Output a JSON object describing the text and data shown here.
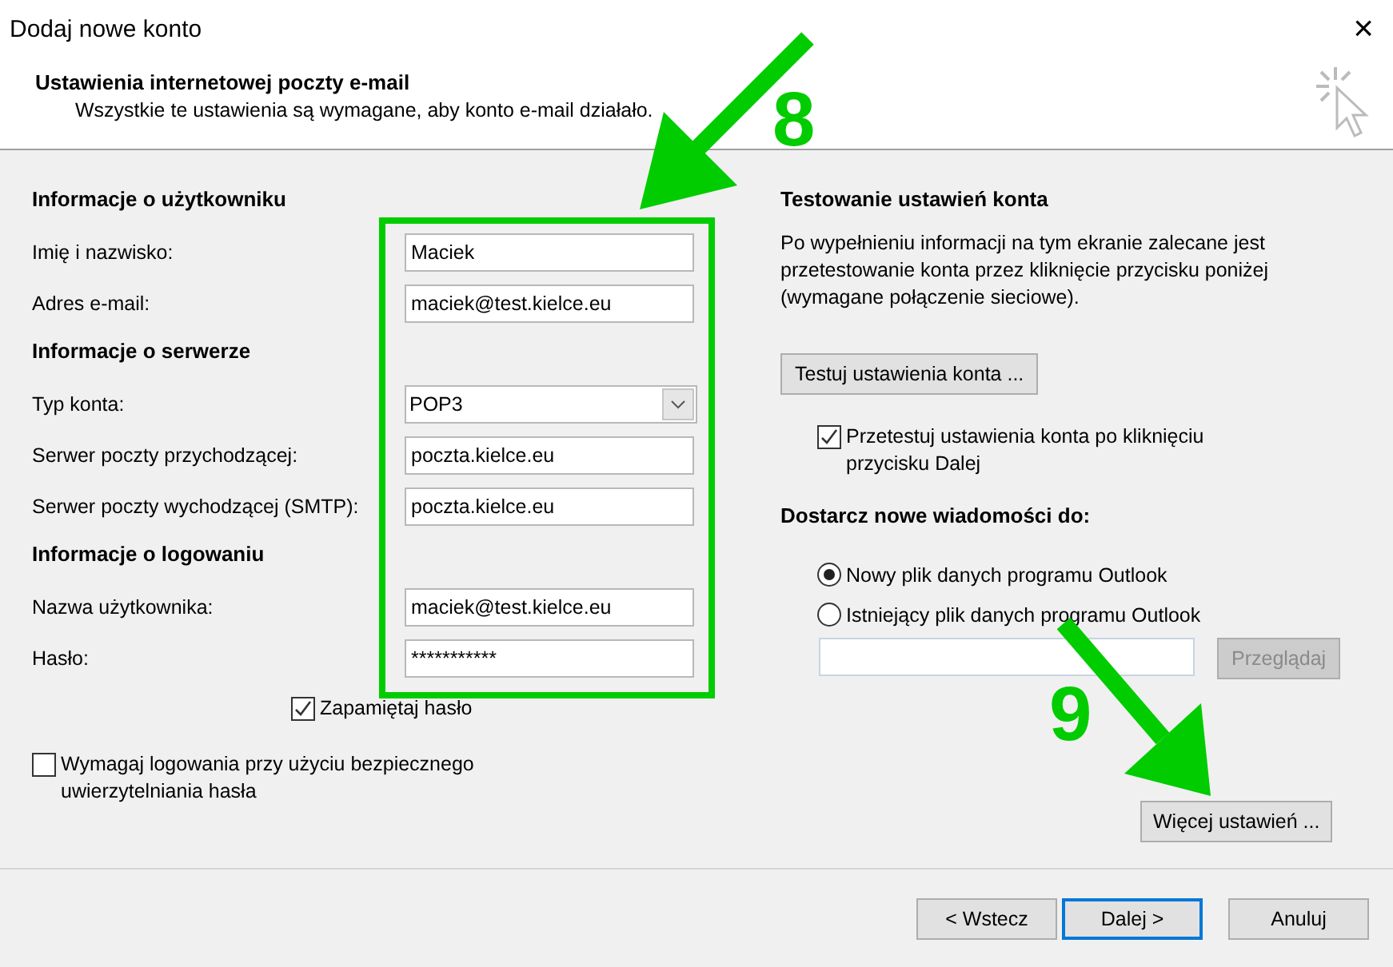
{
  "window": {
    "title": "Dodaj nowe konto",
    "close": "×"
  },
  "header": {
    "title": "Ustawienia internetowej poczty e-mail",
    "subtitle": "Wszystkie te ustawienia są wymagane, aby konto e-mail działało."
  },
  "user_section": {
    "heading": "Informacje o użytkowniku",
    "fields": [
      {
        "label": "Imię i nazwisko:",
        "value": "Maciek",
        "kind": "text"
      },
      {
        "label": "Adres e-mail:",
        "value": "maciek@test.kielce.eu",
        "kind": "text"
      }
    ]
  },
  "server_section": {
    "heading": "Informacje o serwerze",
    "fields": [
      {
        "label": "Typ konta:",
        "value": "POP3",
        "kind": "dropdown"
      },
      {
        "label": "Serwer poczty przychodzącej:",
        "value": "poczta.kielce.eu",
        "kind": "text"
      },
      {
        "label": "Serwer poczty wychodzącej (SMTP):",
        "value": "poczta.kielce.eu",
        "kind": "text"
      }
    ]
  },
  "login_section": {
    "heading": "Informacje o logowaniu",
    "fields": [
      {
        "label": "Nazwa użytkownika:",
        "value": "maciek@test.kielce.eu",
        "kind": "text"
      },
      {
        "label": "Hasło:",
        "value": "***********",
        "kind": "text"
      }
    ]
  },
  "remember_password": {
    "label": "Zapamiętaj hasło",
    "checked": true
  },
  "secure_auth": {
    "label": "Wymagaj logowania przy użyciu bezpiecznego uwierzytelniania hasła",
    "checked": false
  },
  "test_section": {
    "heading": "Testowanie ustawień konta",
    "text": "Po wypełnieniu informacji na tym ekranie zalecane jest przetestowanie konta przez kliknięcie przycisku poniżej (wymagane połączenie sieciowe).",
    "button": "Testuj ustawienia konta ...",
    "auto_test": {
      "label": "Przetestuj ustawienia konta po kliknięciu przycisku Dalej",
      "checked": true
    }
  },
  "deliver_section": {
    "heading": "Dostarcz nowe wiadomości do:",
    "options": [
      {
        "label": "Nowy plik danych programu Outlook",
        "selected": true
      },
      {
        "label": "Istniejący plik danych programu Outlook",
        "selected": false
      }
    ],
    "browse_button": {
      "label": "Przeglądaj",
      "disabled": true
    }
  },
  "more_settings_button": "Więcej ustawień ...",
  "footer_buttons": [
    {
      "label": "< Wstecz",
      "selected": false
    },
    {
      "label": "Dalej >",
      "selected": true
    },
    {
      "label": "Anuluj",
      "selected": false
    }
  ],
  "annotations": [
    {
      "number": "8"
    },
    {
      "number": "9"
    }
  ]
}
